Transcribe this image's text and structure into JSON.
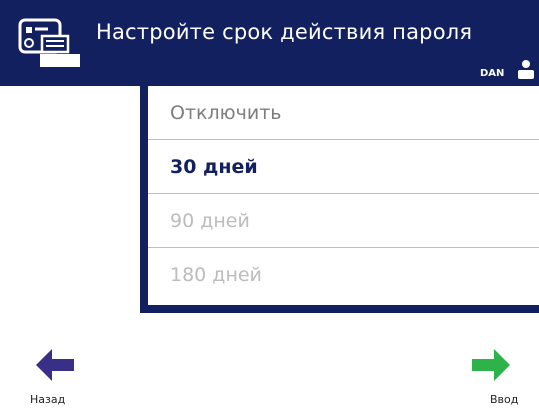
{
  "header": {
    "title": "Настройте срок действия пароля",
    "user": "DAN",
    "icon": "password-settings-icon",
    "background_color": "#13205f"
  },
  "options": [
    {
      "label": "Отключить",
      "state": "enabled"
    },
    {
      "label": "30 дней",
      "state": "selected"
    },
    {
      "label": "90 дней",
      "state": "disabled"
    },
    {
      "label": "180 дней",
      "state": "disabled"
    }
  ],
  "navigation": {
    "back_label": "Назад",
    "back_icon": "back-arrow-icon",
    "back_color": "#3a2f86",
    "enter_label": "Ввод",
    "enter_icon": "enter-arrow-icon",
    "enter_color": "#2db34a"
  }
}
